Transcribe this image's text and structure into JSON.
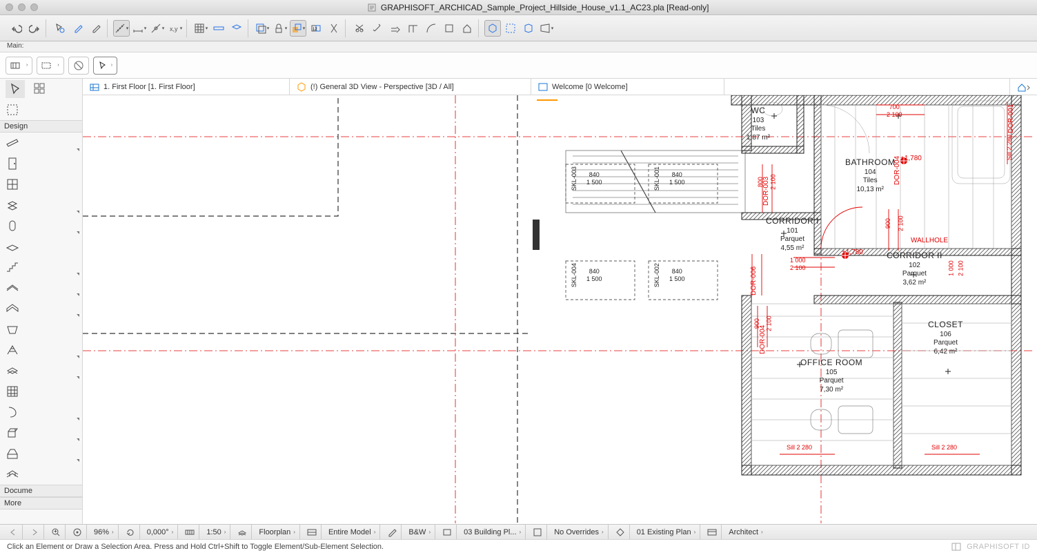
{
  "window": {
    "title": "GRAPHISOFT_ARCHICAD_Sample_Project_Hillside_House_v1.1_AC23.pla [Read-only]"
  },
  "subbar": {
    "label": "Main:"
  },
  "tabs": {
    "t1": "1. First Floor [1. First Floor]",
    "t2": "(!) General 3D View - Perspective [3D / All]",
    "t3": "Welcome [0 Welcome]"
  },
  "toolbox": {
    "section_design": "Design",
    "section_docume": "Docume",
    "section_more": "More"
  },
  "rooms": {
    "wc": {
      "name": "WC",
      "id": "103",
      "mat": "Tiles",
      "area": "1,87 m²"
    },
    "bath": {
      "name": "BATHROOM",
      "id": "104",
      "mat": "Tiles",
      "area": "10,13 m²"
    },
    "corr1": {
      "name": "CORRIDOR I",
      "id": "101",
      "mat": "Parquet",
      "area": "4,55 m²"
    },
    "corr2": {
      "name": "CORRIDOR II",
      "id": "102",
      "mat": "Parquet",
      "area": "3,62 m²"
    },
    "office": {
      "name": "OFFICE ROOM",
      "id": "105",
      "mat": "Parquet",
      "area": "7,30 m²"
    },
    "closet": {
      "name": "CLOSET",
      "id": "106",
      "mat": "Parquet",
      "area": "6,42 m²"
    }
  },
  "annotations": {
    "level1": "+1,780",
    "level2": "+1,780",
    "dor001": "DOR-001",
    "dor003": "DOR-003",
    "dor004a": "DOR-004",
    "dor004b": "DOR-004",
    "dor006": "DOR-006",
    "wallhole": "WALLHOLE",
    "w700": "700",
    "w2100a": "2 100",
    "w800": "800",
    "w2100b": "2 100",
    "w900a": "900",
    "w2100c": "2 100",
    "w1000a": "1 000",
    "w2100d": "2 100",
    "w1000b": "1 000",
    "w2100e": "2 100",
    "w900b": "900",
    "w2100f": "2 100",
    "sill1": "Sill 2 280",
    "sill2": "Sill 2 280",
    "sill3": "Sill 2 280",
    "skl002": "SKL-002",
    "skl003": "SKL-003",
    "skl004": "SKL-004",
    "skl001": "SKL-001",
    "sk840a": "840",
    "sk1500a": "1 500",
    "sk840b": "840",
    "sk1500b": "1 500",
    "sk840c": "840",
    "sk1500c": "1 500",
    "sk840d": "840",
    "sk1500d": "1 500"
  },
  "footer": {
    "zoom": "96%",
    "angle": "0,000°",
    "scale": "1:50",
    "view": "Floorplan",
    "model": "Entire Model",
    "bw": "B&W",
    "building": "03 Building Pl...",
    "overrides": "No Overrides",
    "plan": "01 Existing Plan",
    "role": "Architect"
  },
  "status": {
    "hint": "Click an Element or Draw a Selection Area. Press and Hold Ctrl+Shift to Toggle Element/Sub-Element Selection.",
    "brand": "GRAPHISOFT ID"
  }
}
